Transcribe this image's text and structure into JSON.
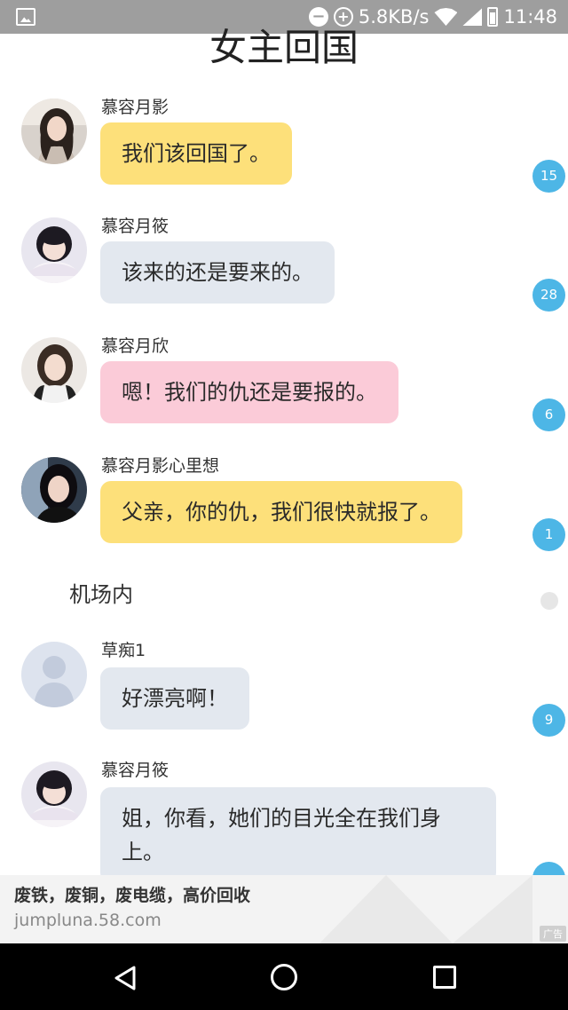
{
  "status_bar": {
    "network_speed": "5.8KB/s",
    "time": "11:48",
    "minus_glyph": "−",
    "plus_glyph": "+",
    "icons": [
      "image-icon",
      "do-not-disturb-icon",
      "data-saver-icon",
      "wifi-icon",
      "signal-icon",
      "battery-icon"
    ]
  },
  "story": {
    "title": "女主回国"
  },
  "messages": [
    {
      "speaker": "慕容月影",
      "text": "我们该回国了。",
      "color": "#fde07a",
      "badge": "15",
      "avatar": "avatar-girl-1"
    },
    {
      "speaker": "慕容月筱",
      "text": "该来的还是要来的。",
      "color": "#e3e8ef",
      "badge": "28",
      "avatar": "avatar-girl-2"
    },
    {
      "speaker": "慕容月欣",
      "text": "嗯！我们的仇还是要报的。",
      "color": "#fbcbd8",
      "badge": "6",
      "avatar": "avatar-girl-3"
    },
    {
      "speaker": "慕容月影心里想",
      "text": "父亲，你的仇，我们很快就报了。",
      "color": "#fde07a",
      "badge": "1",
      "avatar": "avatar-girl-4"
    },
    {
      "speaker": "草痴1",
      "text": "好漂亮啊！",
      "color": "#e3e8ef",
      "badge": "9",
      "avatar": "default-avatar"
    },
    {
      "speaker": "慕容月筱",
      "text": "姐，你看，她们的目光全在我们身上。",
      "color": "#e3e8ef",
      "badge": "",
      "avatar": "avatar-girl-2"
    }
  ],
  "narration": {
    "text": "机场内"
  },
  "ad": {
    "title": "废铁，废铜，废电缆，高价回收",
    "url": "jumpluna.58.com",
    "tag": "广告"
  },
  "nav_bar": {
    "icons": [
      "back-icon",
      "home-icon",
      "recent-apps-icon"
    ]
  }
}
